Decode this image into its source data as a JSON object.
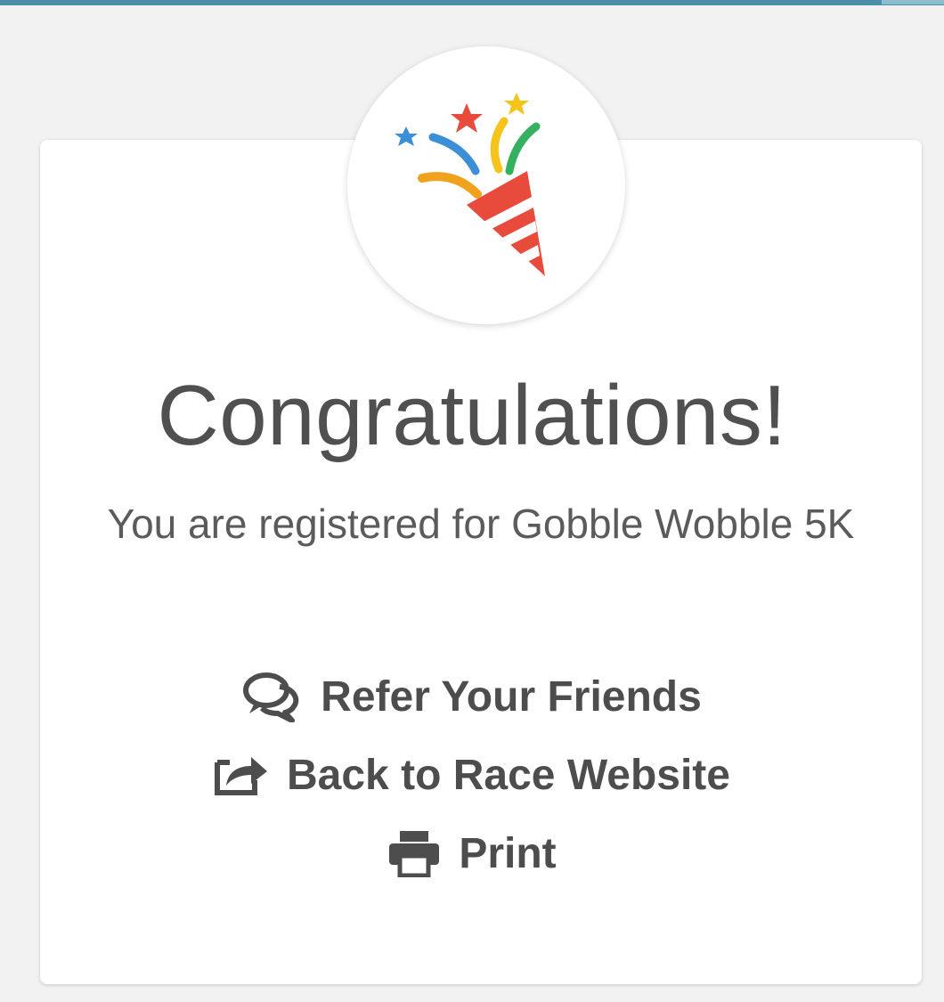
{
  "header": {
    "accent_color": "#4b8ea8"
  },
  "badge": {
    "icon": "party-popper-icon"
  },
  "confirmation": {
    "title": "Congratulations!",
    "message": "You are registered for Gobble Wobble 5K"
  },
  "actions": {
    "refer": {
      "label": "Refer Your Friends",
      "icon": "comments-icon"
    },
    "back": {
      "label": "Back to Race Website",
      "icon": "share-square-icon"
    },
    "print": {
      "label": "Print",
      "icon": "print-icon"
    }
  },
  "colors": {
    "text": "#4f4f4f",
    "card": "#ffffff",
    "background": "#f2f2f2"
  }
}
